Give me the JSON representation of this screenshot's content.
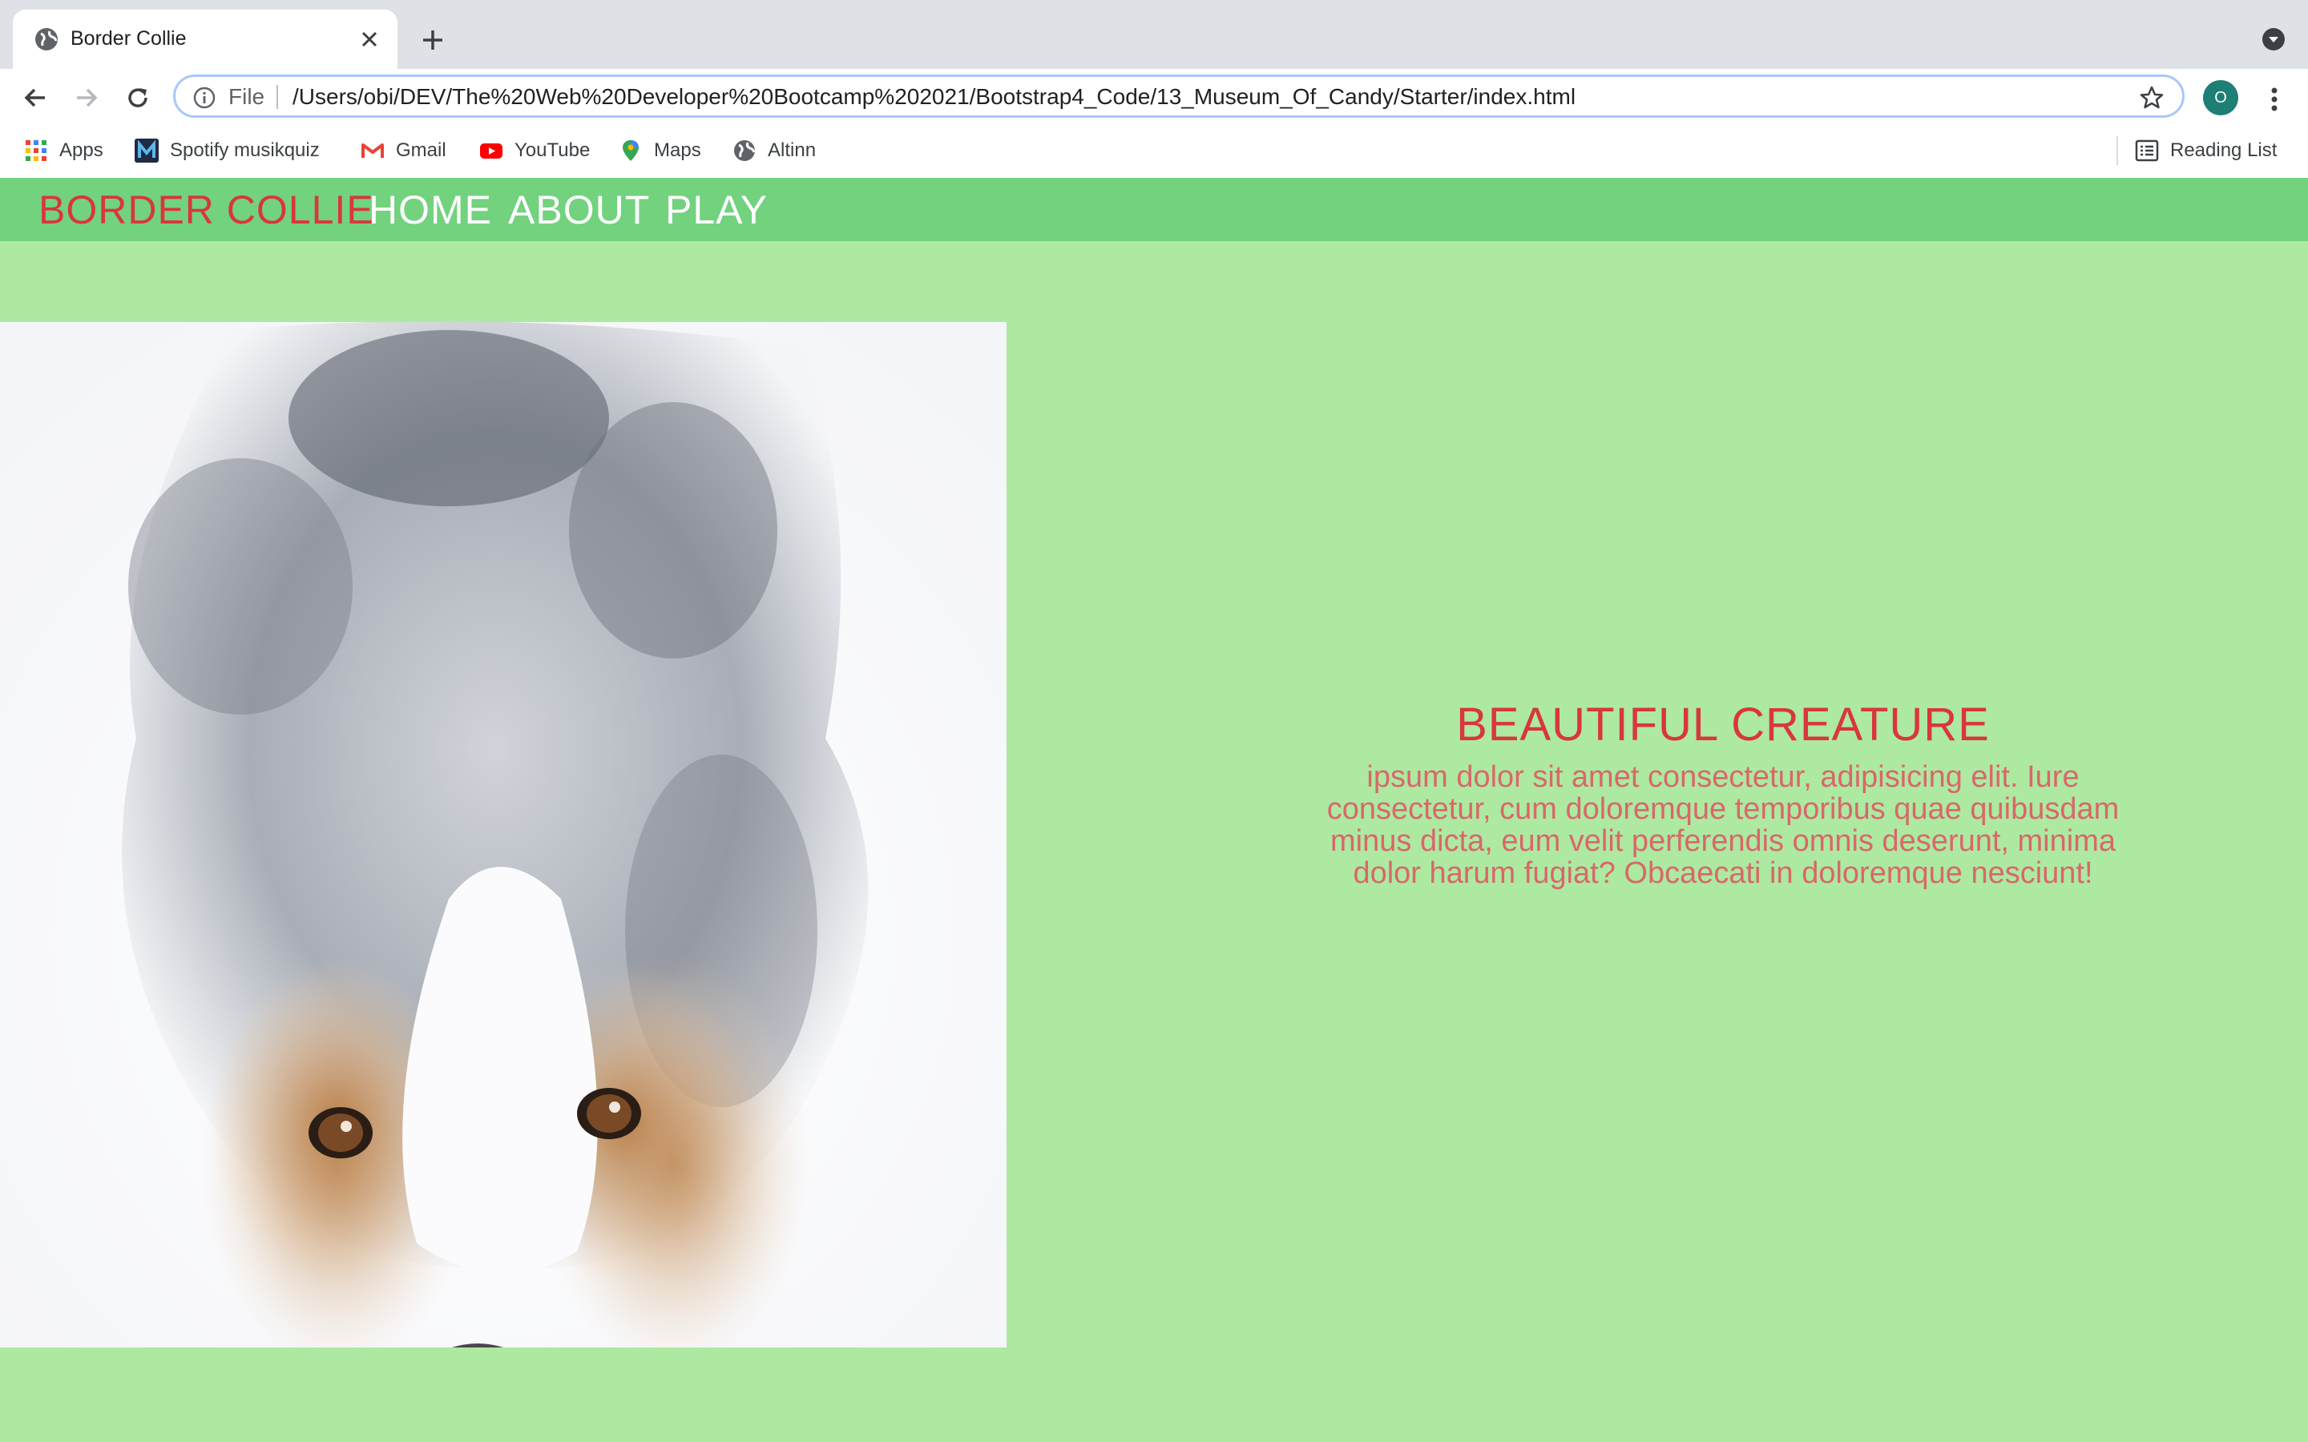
{
  "browser": {
    "tab_title": "Border Collie",
    "address": {
      "scheme_label": "File",
      "url": "/Users/obi/DEV/The%20Web%20Developer%20Bootcamp%202021/Bootstrap4_Code/13_Museum_Of_Candy/Starter/index.html"
    },
    "profile_initial": "O",
    "bookmarks": [
      {
        "label": "Apps",
        "icon": "apps-grid-icon"
      },
      {
        "label": "Spotify musikquiz",
        "icon": "spotify-m-icon"
      },
      {
        "label": "Gmail",
        "icon": "gmail-icon"
      },
      {
        "label": "YouTube",
        "icon": "youtube-icon"
      },
      {
        "label": "Maps",
        "icon": "maps-pin-icon"
      },
      {
        "label": "Altinn",
        "icon": "globe-icon"
      }
    ],
    "reading_list": "Reading List"
  },
  "site": {
    "brand": "BORDER COLLIE",
    "nav": [
      "HOME",
      "ABOUT",
      "PLAY"
    ],
    "hero_image": "dog-photo",
    "heading": "BEAUTIFUL CREATURE",
    "body": "ipsum dolor sit amet consectetur, adipisicing elit. Iure consectetur, cum doloremque temporibus quae quibusdam minus dicta, eum velit perferendis omnis deserunt, minima dolor harum fugiat? Obcaecati in doloremque nesciunt!"
  },
  "colors": {
    "page_bg": "#ade9a0",
    "navbar_bg": "#72d27e",
    "brand_red": "#d9363e",
    "body_text": "#d9676b"
  }
}
